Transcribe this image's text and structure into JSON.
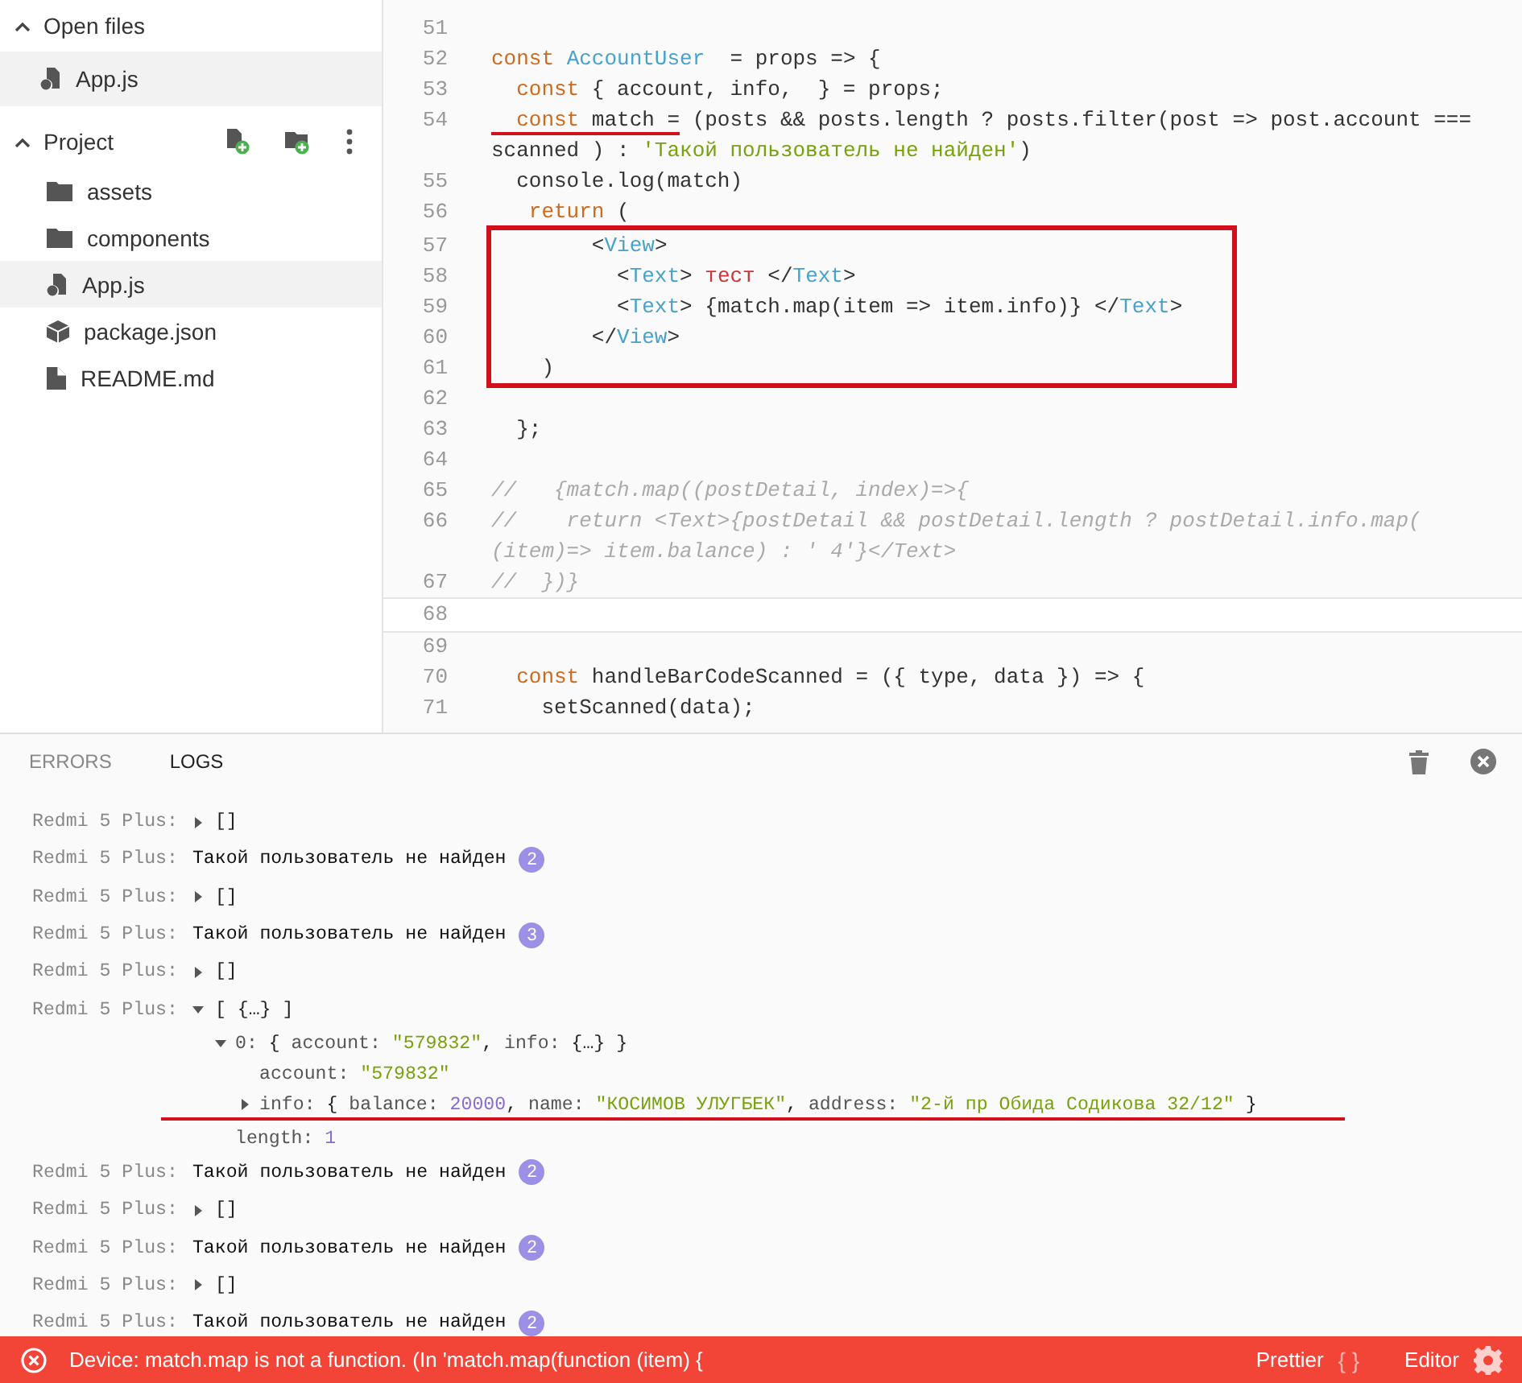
{
  "sidebar": {
    "sections": [
      {
        "title": "Open files",
        "expanded": true,
        "items": [
          {
            "name": "App.js",
            "kind": "js",
            "selected": true
          }
        ]
      },
      {
        "title": "Project",
        "expanded": true,
        "actions": [
          {
            "kind": "new-file"
          },
          {
            "kind": "new-folder"
          },
          {
            "kind": "more"
          }
        ],
        "items": [
          {
            "name": "assets",
            "kind": "folder",
            "selected": false
          },
          {
            "name": "components",
            "kind": "folder",
            "selected": false
          },
          {
            "name": "App.js",
            "kind": "js",
            "selected": true
          },
          {
            "name": "package.json",
            "kind": "package",
            "selected": false
          },
          {
            "name": "README.md",
            "kind": "file",
            "selected": false
          }
        ]
      }
    ]
  },
  "editor": {
    "lines": [
      {
        "number": "51",
        "active": false,
        "boxed": false
      },
      {
        "number": "52",
        "active": false,
        "boxed": false,
        "tokens": [
          {
            "kind": "kw",
            "text": "const"
          },
          {
            "kind": "name",
            "text": " AccountUser"
          },
          {
            "kind": "plain",
            "text": "  = props => {"
          }
        ]
      },
      {
        "number": "53",
        "active": false,
        "boxed": false,
        "tokens": [
          {
            "kind": "kw",
            "text": "  const"
          },
          {
            "kind": "plain",
            "text": " { account, info,  } = props;"
          }
        ]
      },
      {
        "number": "54",
        "active": false,
        "boxed": false,
        "tokens": [
          {
            "kind": "kw",
            "text": "  const",
            "underlined": true
          },
          {
            "kind": "plain",
            "text": " match =",
            "underlined": true
          },
          {
            "kind": "plain",
            "text": " (posts && posts.length ? posts.filter(post => post.account ==="
          }
        ]
      },
      {
        "active": false,
        "boxed": false,
        "tokens": [
          {
            "kind": "plain",
            "text": "scanned ) : "
          },
          {
            "kind": "str",
            "text": "'Такой пользователь не найден'"
          },
          {
            "kind": "plain",
            "text": ")"
          }
        ]
      },
      {
        "number": "55",
        "active": false,
        "boxed": false,
        "tokens": [
          {
            "kind": "plain",
            "text": "  console.log(match)"
          }
        ]
      },
      {
        "number": "56",
        "active": false,
        "boxed": false,
        "tokens": [
          {
            "kind": "kw",
            "text": "   return"
          },
          {
            "kind": "plain",
            "text": " ("
          }
        ]
      },
      {
        "number": "57",
        "active": false,
        "boxed": true,
        "tokens": [
          {
            "kind": "plain",
            "text": "        <"
          },
          {
            "kind": "tag",
            "text": "View"
          },
          {
            "kind": "plain",
            "text": ">"
          }
        ]
      },
      {
        "number": "58",
        "active": false,
        "boxed": true,
        "tokens": [
          {
            "kind": "plain",
            "text": "          <"
          },
          {
            "kind": "tag",
            "text": "Text"
          },
          {
            "kind": "plain",
            "text": "> "
          },
          {
            "kind": "red",
            "text": "тест"
          },
          {
            "kind": "plain",
            "text": " </"
          },
          {
            "kind": "tag",
            "text": "Text"
          },
          {
            "kind": "plain",
            "text": ">"
          }
        ]
      },
      {
        "number": "59",
        "active": false,
        "boxed": true,
        "tokens": [
          {
            "kind": "plain",
            "text": "          <"
          },
          {
            "kind": "tag",
            "text": "Text"
          },
          {
            "kind": "plain",
            "text": "> {match.map(item => item.info)} </"
          },
          {
            "kind": "tag",
            "text": "Text"
          },
          {
            "kind": "plain",
            "text": ">"
          }
        ]
      },
      {
        "number": "60",
        "active": false,
        "boxed": true,
        "tokens": [
          {
            "kind": "plain",
            "text": "        </"
          },
          {
            "kind": "tag",
            "text": "View"
          },
          {
            "kind": "plain",
            "text": ">"
          }
        ]
      },
      {
        "number": "61",
        "active": false,
        "boxed": true,
        "tokens": [
          {
            "kind": "plain",
            "text": "    )"
          }
        ]
      },
      {
        "number": "62",
        "active": false,
        "boxed": false
      },
      {
        "number": "63",
        "active": false,
        "boxed": false,
        "tokens": [
          {
            "kind": "plain",
            "text": "  };"
          }
        ]
      },
      {
        "number": "64",
        "active": false,
        "boxed": false
      },
      {
        "number": "65",
        "active": false,
        "boxed": false,
        "tokens": [
          {
            "kind": "comment",
            "text": "//   {match.map((postDetail, index)=>{"
          }
        ]
      },
      {
        "number": "66",
        "active": false,
        "boxed": false,
        "tokens": [
          {
            "kind": "comment",
            "text": "//    return <Text>{postDetail && postDetail.length ? postDetail.info.map("
          }
        ]
      },
      {
        "active": false,
        "boxed": false,
        "tokens": [
          {
            "kind": "comment",
            "text": "(item)=> item.balance) : ' 4'}</Text>"
          }
        ]
      },
      {
        "number": "67",
        "active": false,
        "boxed": false,
        "tokens": [
          {
            "kind": "comment",
            "text": "//  })}"
          }
        ]
      },
      {
        "number": "68",
        "active": true,
        "boxed": false
      },
      {
        "number": "69",
        "active": false,
        "boxed": false
      },
      {
        "number": "70",
        "active": false,
        "boxed": false,
        "tokens": [
          {
            "kind": "kw",
            "text": "  const"
          },
          {
            "kind": "plain",
            "text": " handleBarCodeScanned = ({ type, data }) => {"
          }
        ]
      },
      {
        "number": "71",
        "active": false,
        "boxed": false,
        "tokens": [
          {
            "kind": "plain",
            "text": "    setScanned(data);"
          }
        ]
      }
    ]
  },
  "console": {
    "tabs": [
      {
        "label": "ERRORS",
        "selected": false
      },
      {
        "label": "LOGS",
        "selected": true
      }
    ],
    "logs": [
      {
        "source": "Redmi 5 Plus:",
        "kind": "value",
        "expanded": false,
        "tokens": [
          {
            "kind": "punct",
            "text": "[]"
          }
        ]
      },
      {
        "source": "Redmi 5 Plus:",
        "kind": "message",
        "text": "Такой пользователь не найден",
        "count": "2"
      },
      {
        "source": "Redmi 5 Plus:",
        "kind": "value",
        "expanded": false,
        "tokens": [
          {
            "kind": "punct",
            "text": "[]"
          }
        ]
      },
      {
        "source": "Redmi 5 Plus:",
        "kind": "message",
        "text": "Такой пользователь не найден",
        "count": "3"
      },
      {
        "source": "Redmi 5 Plus:",
        "kind": "value",
        "expanded": false,
        "tokens": [
          {
            "kind": "punct",
            "text": "[]"
          }
        ]
      },
      {
        "source": "Redmi 5 Plus:",
        "kind": "value",
        "expanded": true,
        "tokens": [
          {
            "kind": "punct",
            "text": "[ {…} ]"
          }
        ],
        "children": [
          {
            "expanded": true,
            "tokens": [
              {
                "kind": "key",
                "text": "0:"
              },
              {
                "kind": "punct",
                "text": " { "
              },
              {
                "kind": "key",
                "text": "account:"
              },
              {
                "kind": "str",
                "text": " \"579832\""
              },
              {
                "kind": "punct",
                "text": ", "
              },
              {
                "kind": "key",
                "text": "info:"
              },
              {
                "kind": "punct",
                "text": " {…} }"
              }
            ],
            "children": [
              {
                "tokens": [
                  {
                    "kind": "key",
                    "text": "account:"
                  },
                  {
                    "kind": "str",
                    "text": " \"579832\""
                  }
                ]
              },
              {
                "expanded": false,
                "underlined": true,
                "tokens": [
                  {
                    "kind": "key",
                    "text": "info:"
                  },
                  {
                    "kind": "punct",
                    "text": " { "
                  },
                  {
                    "kind": "key",
                    "text": "balance:"
                  },
                  {
                    "kind": "num",
                    "text": " 20000"
                  },
                  {
                    "kind": "punct",
                    "text": ", "
                  },
                  {
                    "kind": "key",
                    "text": "name:"
                  },
                  {
                    "kind": "str",
                    "text": " \"КОСИМОВ УЛУГБЕК\""
                  },
                  {
                    "kind": "punct",
                    "text": ", "
                  },
                  {
                    "kind": "key",
                    "text": "address:"
                  },
                  {
                    "kind": "str",
                    "text": " \"2-й пр Обида Содикова 32/12\""
                  },
                  {
                    "kind": "punct",
                    "text": " }"
                  }
                ]
              }
            ]
          },
          {
            "tokens": [
              {
                "kind": "key",
                "text": "length:"
              },
              {
                "kind": "num",
                "text": " 1"
              }
            ]
          }
        ]
      },
      {
        "source": "Redmi 5 Plus:",
        "kind": "message",
        "text": "Такой пользователь не найден",
        "count": "2"
      },
      {
        "source": "Redmi 5 Plus:",
        "kind": "value",
        "expanded": false,
        "tokens": [
          {
            "kind": "punct",
            "text": "[]"
          }
        ]
      },
      {
        "source": "Redmi 5 Plus:",
        "kind": "message",
        "text": "Такой пользователь не найден",
        "count": "2"
      },
      {
        "source": "Redmi 5 Plus:",
        "kind": "value",
        "expanded": false,
        "tokens": [
          {
            "kind": "punct",
            "text": "[]"
          }
        ]
      },
      {
        "source": "Redmi 5 Plus:",
        "kind": "message",
        "text": "Такой пользователь не найден",
        "count": "2"
      }
    ]
  },
  "status_bar": {
    "error": "Device: match.map is not a function. (In 'match.map(function (item) {",
    "items": [
      {
        "kind": "glyph",
        "label": "Prettier",
        "glyph": "{ }"
      },
      {
        "kind": "gear",
        "label": "Editor"
      }
    ]
  }
}
